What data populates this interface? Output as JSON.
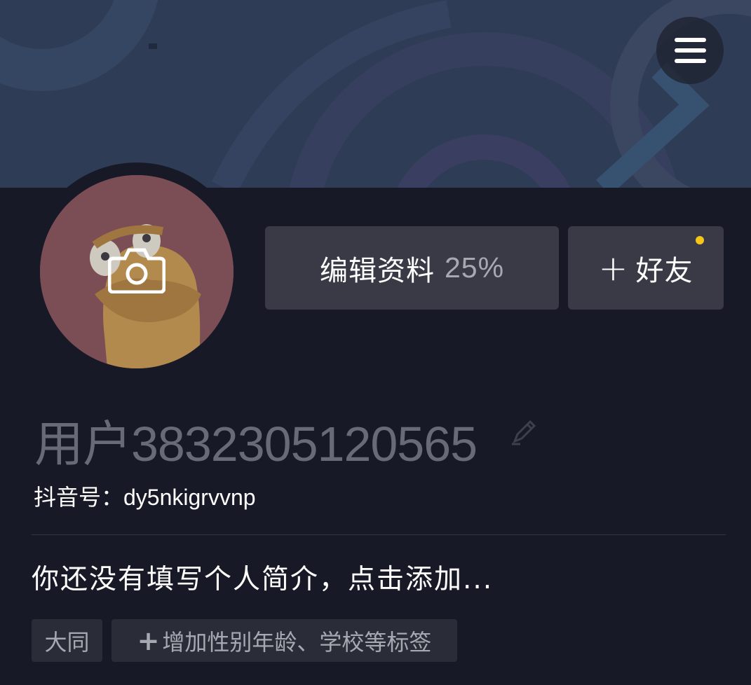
{
  "header": {
    "menu_icon": "hamburger-menu-icon"
  },
  "profile": {
    "avatar_icon": "camera-icon",
    "username": "用户3832305120565",
    "edit_name_icon": "pencil-icon",
    "douyin_id": "抖音号：dy5nkigrvvnp",
    "bio": "你还没有填写个人简介，点击添加..."
  },
  "actions": {
    "edit_profile_label": "编辑资料",
    "edit_profile_progress": "25%",
    "add_friend_plus": "+",
    "add_friend_label": "好友",
    "add_friend_notification_color": "#f5c518"
  },
  "tags": {
    "city": "大同",
    "add_plus": "+",
    "add_label": "增加性别年龄、学校等标签"
  },
  "colors": {
    "background": "#171a26",
    "banner": "#2f3c56",
    "button": "#393a45",
    "tag": "#2a2c37"
  }
}
